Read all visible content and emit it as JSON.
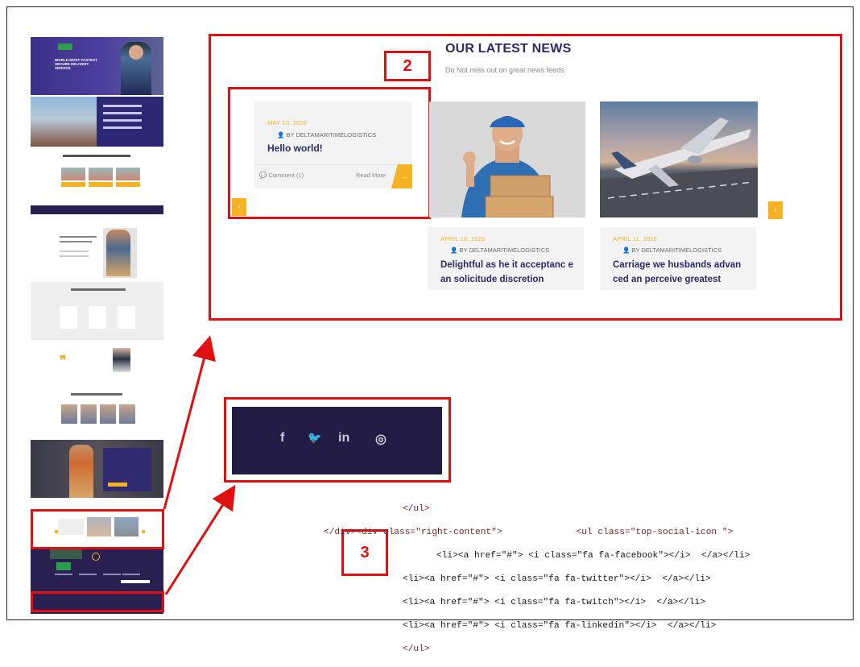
{
  "news": {
    "title": "OUR LATEST NEWS",
    "subtitle": "Do Not miss out on great news feeds",
    "cards": [
      {
        "date": "MAY 13, 2020",
        "author": "BY DELTAMARITIMELOGISTICS",
        "title": "Hello world!",
        "comments": "Comment (1)",
        "read_more": "Read More"
      },
      {
        "date": "APRIL 10, 2020",
        "author": "BY DELTAMARITIMELOGISTICS",
        "title": "Delightful as he it acceptanc e an solicitude discretion"
      },
      {
        "date": "APRIL 11, 2020",
        "author": "BY DELTAMARITIMELOGISTICS",
        "title": "Carriage we husbands advan ced an perceive greatest"
      }
    ]
  },
  "thumbnail": {
    "hero_text": "WORLD MOST FASTEST SECURE DELIVERY SERVICE"
  },
  "social": {
    "icons": [
      "f",
      "🐦",
      "in",
      "◎"
    ]
  },
  "labels": {
    "box2": "2",
    "box3": "3"
  },
  "code_lines": [
    "</ul>",
    "</div><div class=\"right-content\">",
    "<ul class=\"top-social-icon \">",
    "<li><a href=\"#\"> <i class=\"fa fa-facebook\"></i>  </a></li>",
    "<li><a href=\"#\"> <i class=\"fa fa-twitter\"></i>  </a></li>",
    "<li><a href=\"#\"> <i class=\"fa fa-twitch\"></i>  </a></li>",
    "<li><a href=\"#\"> <i class=\"fa fa-linkedin\"></i>  </a></li>",
    "</ul>"
  ],
  "colors": {
    "accent": "#f5b324",
    "navy": "#2c2a66",
    "annotation_red": "#e01010",
    "footer": "#221c44"
  }
}
